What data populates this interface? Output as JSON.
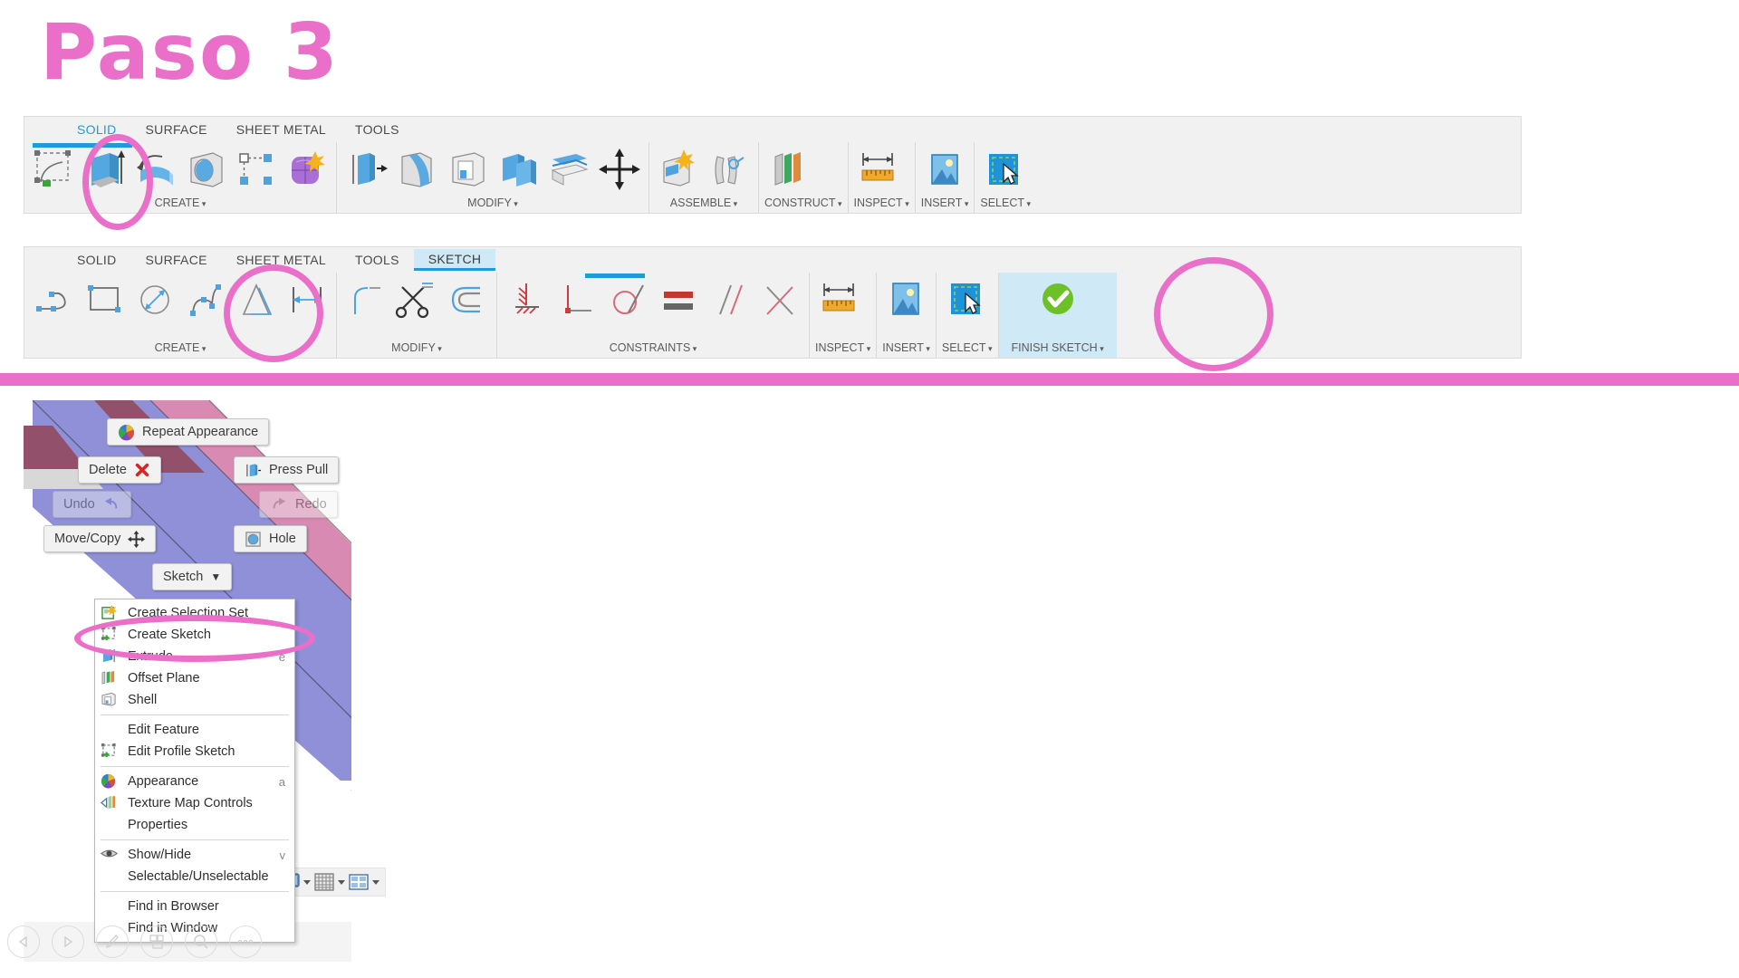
{
  "title": "Paso 3",
  "colors": {
    "accent_pink": "#ea6fc8",
    "ribbon_bg": "#f1f1f1",
    "tab_active_blue": "#1f9bd6",
    "sketch_tab_bg": "#cfe9f7",
    "finish_sketch_bg": "#cfe9f7",
    "model_purple": "#8f90d8",
    "model_pink": "#d98ab3",
    "model_dark_mauve": "#93506a"
  },
  "toolbar_solid": {
    "name": "solid-ribbon",
    "tabs": [
      {
        "label": "SOLID",
        "active": true
      },
      {
        "label": "SURFACE",
        "active": false
      },
      {
        "label": "SHEET METAL",
        "active": false
      },
      {
        "label": "TOOLS",
        "active": false
      }
    ],
    "panels": [
      {
        "label": "CREATE",
        "dropdown": true,
        "tools": [
          {
            "name": "sketch-icon",
            "title": "Create Sketch"
          },
          {
            "name": "extrude-icon",
            "title": "Extrude",
            "highlighted": true
          },
          {
            "name": "revolve-icon",
            "title": "Revolve"
          },
          {
            "name": "sweep-icon",
            "title": "Sweep"
          },
          {
            "name": "pattern-icon",
            "title": "Pattern"
          },
          {
            "name": "form-icon",
            "title": "Create Form"
          }
        ]
      },
      {
        "label": "MODIFY",
        "dropdown": true,
        "tools": [
          {
            "name": "press-pull-icon",
            "title": "Press Pull"
          },
          {
            "name": "fillet-icon",
            "title": "Fillet"
          },
          {
            "name": "shell-icon",
            "title": "Shell"
          },
          {
            "name": "combine-icon",
            "title": "Combine"
          },
          {
            "name": "split-face-icon",
            "title": "Split Face"
          },
          {
            "name": "move-copy-icon",
            "title": "Move/Copy"
          }
        ]
      },
      {
        "label": "ASSEMBLE",
        "dropdown": true,
        "tools": [
          {
            "name": "new-component-icon",
            "title": "New Component"
          },
          {
            "name": "joint-icon",
            "title": "Joint"
          }
        ]
      },
      {
        "label": "CONSTRUCT",
        "dropdown": true,
        "tools": [
          {
            "name": "offset-plane-icon",
            "title": "Offset Plane"
          }
        ]
      },
      {
        "label": "INSPECT",
        "dropdown": true,
        "tools": [
          {
            "name": "measure-icon",
            "title": "Measure"
          }
        ]
      },
      {
        "label": "INSERT",
        "dropdown": true,
        "tools": [
          {
            "name": "insert-image-icon",
            "title": "Insert Canvas"
          }
        ]
      },
      {
        "label": "SELECT",
        "dropdown": true,
        "tools": [
          {
            "name": "select-cursor-icon",
            "title": "Select"
          }
        ]
      }
    ]
  },
  "toolbar_sketch": {
    "name": "sketch-ribbon",
    "tabs": [
      {
        "label": "SOLID",
        "active": false
      },
      {
        "label": "SURFACE",
        "active": false
      },
      {
        "label": "SHEET METAL",
        "active": false
      },
      {
        "label": "TOOLS",
        "active": false
      },
      {
        "label": "SKETCH",
        "active": true
      }
    ],
    "panels": [
      {
        "label": "CREATE",
        "dropdown": true,
        "tools": [
          {
            "name": "line-icon",
            "title": "Line"
          },
          {
            "name": "rectangle-icon",
            "title": "Rectangle"
          },
          {
            "name": "circle-icon",
            "title": "Circle"
          },
          {
            "name": "spline-icon",
            "title": "Spline"
          },
          {
            "name": "polygon-icon",
            "title": "Polygon"
          },
          {
            "name": "sketch-dimension-icon",
            "title": "Sketch Dimension"
          }
        ]
      },
      {
        "label": "MODIFY",
        "dropdown": true,
        "tools": [
          {
            "name": "fillet-sketch-icon",
            "title": "Fillet"
          },
          {
            "name": "trim-icon",
            "title": "Trim"
          },
          {
            "name": "offset-icon",
            "title": "Offset"
          }
        ]
      },
      {
        "label": "CONSTRAINTS",
        "dropdown": true,
        "tools": [
          {
            "name": "coincident-icon",
            "title": "Coincident"
          },
          {
            "name": "perpendicular-icon",
            "title": "Perpendicular"
          },
          {
            "name": "tangent-icon",
            "title": "Tangent"
          },
          {
            "name": "equal-icon",
            "title": "Equal"
          },
          {
            "name": "parallel-icon",
            "title": "Parallel"
          },
          {
            "name": "midpoint-icon",
            "title": "Midpoint"
          }
        ]
      },
      {
        "label": "INSPECT",
        "dropdown": true,
        "tools": [
          {
            "name": "measure-icon",
            "title": "Measure"
          }
        ]
      },
      {
        "label": "INSERT",
        "dropdown": true,
        "tools": [
          {
            "name": "insert-image-icon",
            "title": "Insert Canvas"
          }
        ]
      },
      {
        "label": "SELECT",
        "dropdown": true,
        "tools": [
          {
            "name": "select-cursor-icon",
            "title": "Select"
          }
        ]
      },
      {
        "label": "FINISH SKETCH",
        "dropdown": true,
        "highlight": true,
        "tools": [
          {
            "name": "finish-sketch-check-icon",
            "title": "Finish Sketch"
          }
        ]
      }
    ]
  },
  "marking_menu": {
    "name": "marking-menu",
    "items": [
      {
        "label": "Repeat Appearance",
        "icon": "color-wheel-icon",
        "icon_side": "left",
        "disabled": false
      },
      {
        "label": "Delete",
        "icon": "red-x-icon",
        "icon_side": "right",
        "disabled": false
      },
      {
        "label": "Press Pull",
        "icon": "press-pull-icon",
        "icon_side": "left",
        "disabled": false
      },
      {
        "label": "Undo",
        "icon": "undo-arrow-icon",
        "icon_side": "right",
        "disabled": true
      },
      {
        "label": "Redo",
        "icon": "redo-arrow-icon",
        "icon_side": "left",
        "disabled": true
      },
      {
        "label": "Move/Copy",
        "icon": "move-arrows-icon",
        "icon_side": "right",
        "disabled": false
      },
      {
        "label": "Hole",
        "icon": "hole-icon",
        "icon_side": "left",
        "disabled": false
      },
      {
        "label": "Sketch",
        "icon": "chevron-down-icon",
        "icon_side": "right",
        "disabled": false
      }
    ]
  },
  "context_menu": {
    "name": "sketch-context-menu",
    "groups": [
      {
        "items": [
          {
            "label": "Create Selection Set",
            "icon": "create-selection-set-icon",
            "shortcut": ""
          },
          {
            "label": "Create Sketch",
            "icon": "create-sketch-icon",
            "shortcut": "",
            "annotated": true
          },
          {
            "label": "Extrude",
            "icon": "extrude-icon",
            "shortcut": "e"
          },
          {
            "label": "Offset Plane",
            "icon": "offset-plane-icon",
            "shortcut": ""
          },
          {
            "label": "Shell",
            "icon": "shell-icon",
            "shortcut": ""
          }
        ]
      },
      {
        "items": [
          {
            "label": "Edit Feature",
            "icon": "",
            "shortcut": ""
          },
          {
            "label": "Edit Profile Sketch",
            "icon": "edit-profile-sketch-icon",
            "shortcut": ""
          }
        ]
      },
      {
        "items": [
          {
            "label": "Appearance",
            "icon": "color-wheel-icon",
            "shortcut": "a"
          },
          {
            "label": "Texture Map Controls",
            "icon": "texture-map-icon",
            "shortcut": ""
          },
          {
            "label": "Properties",
            "icon": "",
            "shortcut": ""
          }
        ]
      },
      {
        "items": [
          {
            "label": "Show/Hide",
            "icon": "eye-icon",
            "shortcut": "v"
          },
          {
            "label": "Selectable/Unselectable",
            "icon": "",
            "shortcut": ""
          }
        ]
      },
      {
        "items": [
          {
            "label": "Find in Browser",
            "icon": "",
            "shortcut": ""
          },
          {
            "label": "Find in Window",
            "icon": "",
            "shortcut": ""
          }
        ]
      }
    ]
  },
  "display_bar": {
    "name": "display-settings-bar",
    "buttons": [
      {
        "name": "display-settings-icon",
        "dropdown": true
      },
      {
        "name": "grid-snaps-icon",
        "dropdown": true
      },
      {
        "name": "viewports-icon",
        "dropdown": true
      }
    ]
  },
  "bottom_nav": {
    "name": "timeline-nav",
    "buttons": [
      {
        "name": "previous-step-icon"
      },
      {
        "name": "play-step-icon"
      },
      {
        "name": "edit-pencil-icon"
      },
      {
        "name": "browser-panels-icon"
      },
      {
        "name": "search-icon"
      },
      {
        "name": "more-options-icon"
      }
    ]
  },
  "annotations": [
    {
      "name": "annotation-circle-extrude",
      "target": "extrude-tool-solid-ribbon"
    },
    {
      "name": "annotation-circle-spline",
      "target": "spline-tool-sketch-ribbon"
    },
    {
      "name": "annotation-circle-insert",
      "target": "insert-panel-sketch-ribbon"
    },
    {
      "name": "annotation-circle-create-sketch",
      "target": "create-sketch-menu-item"
    }
  ]
}
